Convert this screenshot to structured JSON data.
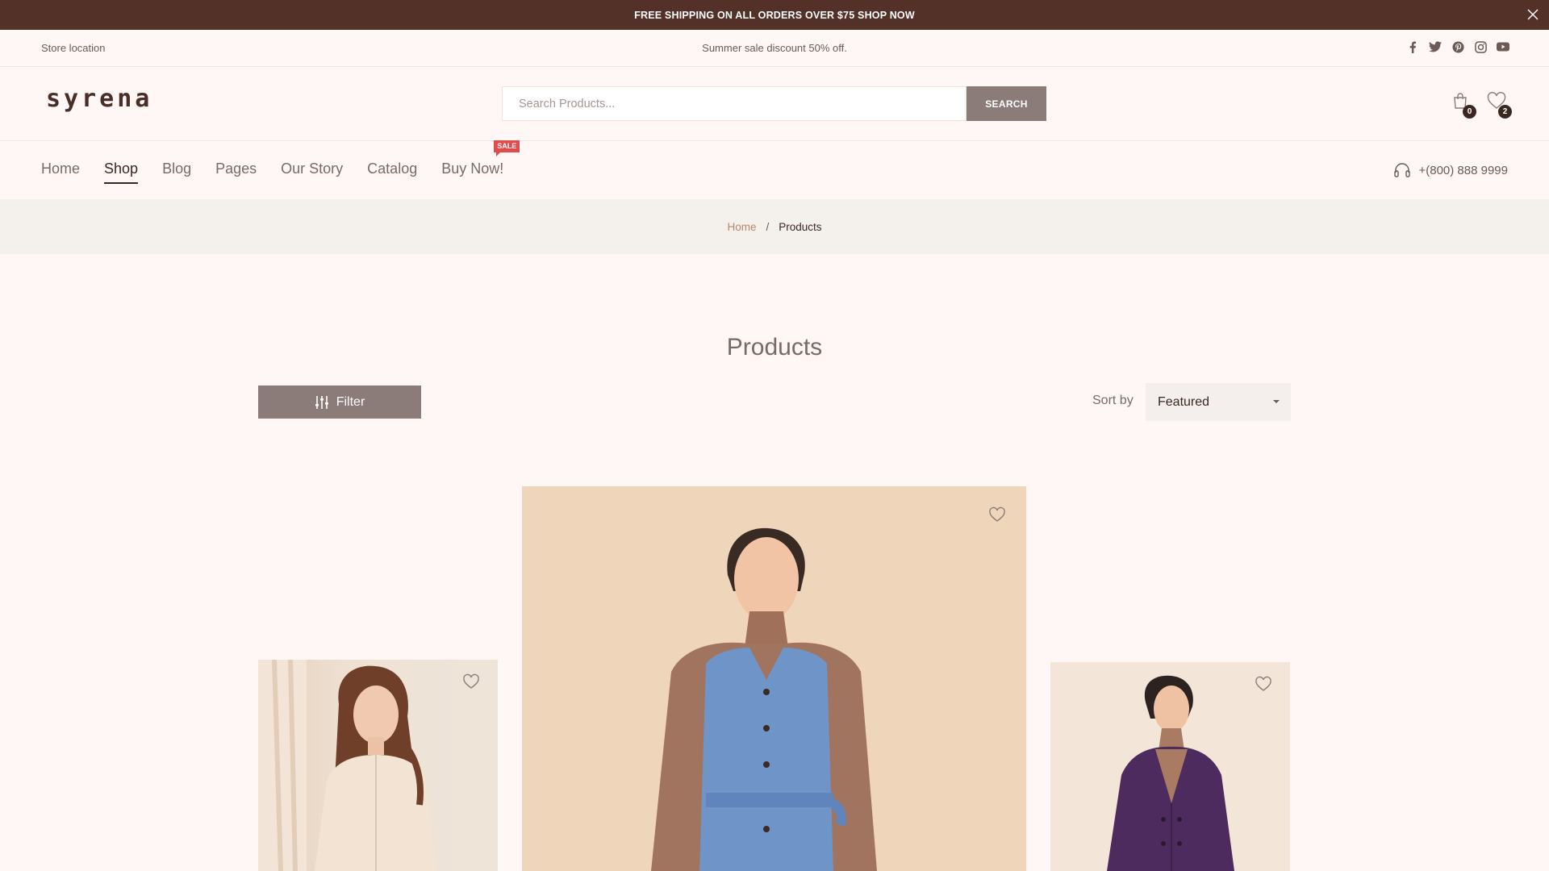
{
  "announcement": {
    "text": "FREE SHIPPING ON ALL ORDERS OVER $75 SHOP NOW"
  },
  "topbar": {
    "store_location": "Store location",
    "promo": "Summer sale discount 50% off.",
    "social": [
      "facebook-icon",
      "twitter-icon",
      "pinterest-icon",
      "instagram-icon",
      "youtube-icon"
    ]
  },
  "header": {
    "logo": "syrena",
    "search_placeholder": "Search Products...",
    "search_button": "SEARCH",
    "cart_count": "0",
    "wishlist_count": "2"
  },
  "nav": {
    "items": [
      "Home",
      "Shop",
      "Blog",
      "Pages",
      "Our Story",
      "Catalog",
      "Buy Now!"
    ],
    "active": "Shop",
    "sale_tag": "SALE",
    "phone": "+(800) 888 9999"
  },
  "breadcrumb": {
    "home": "Home",
    "separator": "/",
    "current": "Products"
  },
  "page": {
    "title": "Products",
    "filter_label": "Filter",
    "sort_label": "Sort by",
    "sort_value": "Featured"
  },
  "colors": {
    "announcement_bg": "#533129",
    "accent_button": "#8b7b79",
    "sale_tag": "#e14b4b",
    "page_bg": "#fff7f5"
  }
}
